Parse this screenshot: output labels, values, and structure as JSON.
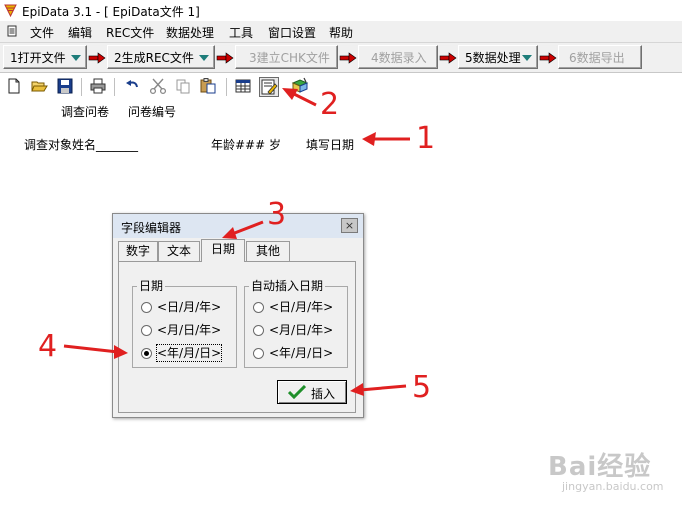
{
  "window": {
    "title": "EpiData 3.1 - [ EpiData文件 1]"
  },
  "menu": [
    "文件",
    "编辑",
    "REC文件",
    "数据处理",
    "工具",
    "窗口设置",
    "帮助"
  ],
  "workflow": [
    {
      "label": "1打开文件",
      "enabled": true,
      "dropdown": true
    },
    {
      "label": "2生成REC文件",
      "enabled": true,
      "dropdown": true
    },
    {
      "label": "3建立CHK文件",
      "enabled": false,
      "dropdown": false
    },
    {
      "label": "4数据录入",
      "enabled": false,
      "dropdown": false
    },
    {
      "label": "5数据处理",
      "enabled": true,
      "dropdown": true
    },
    {
      "label": "6数据导出",
      "enabled": false,
      "dropdown": false
    }
  ],
  "document": {
    "heading_left": "调查问卷",
    "heading_right": "问卷编号",
    "name_field": "调查对象姓名_______",
    "age_field": "年龄### 岁",
    "date_field": "填写日期"
  },
  "dialog": {
    "title": "字段编辑器",
    "close_glyph": "×",
    "tabs": [
      {
        "label": "数字",
        "active": false
      },
      {
        "label": "文本",
        "active": false
      },
      {
        "label": "日期",
        "active": true
      },
      {
        "label": "其他",
        "active": false
      }
    ],
    "date_group": {
      "title": "日期",
      "options": [
        {
          "label": "<日/月/年>",
          "selected": false
        },
        {
          "label": "<月/日/年>",
          "selected": false
        },
        {
          "label": "<年/月/日>",
          "selected": true
        }
      ]
    },
    "auto_group": {
      "title": "自动插入日期",
      "options": [
        {
          "label": "<日/月/年>",
          "selected": false
        },
        {
          "label": "<月/日/年>",
          "selected": false
        },
        {
          "label": "<年/月/日>",
          "selected": false
        }
      ]
    },
    "insert_label": "插入"
  },
  "annotations": [
    "1",
    "2",
    "3",
    "4",
    "5"
  ],
  "watermark": {
    "big": "Bai经验",
    "small": "jingyan.baidu.com"
  },
  "colors": {
    "accent_red": "#e02020",
    "flow_arrow_red": "#cc0000",
    "dropdown_teal": "#1e7d7a"
  }
}
